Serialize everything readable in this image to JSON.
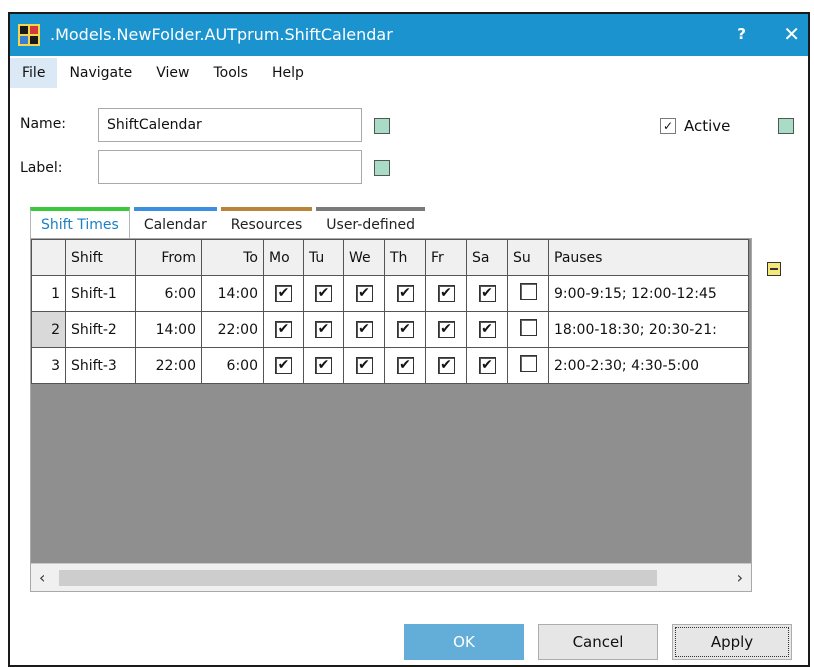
{
  "window": {
    "title": ".Models.NewFolder.AUTprum.ShiftCalendar",
    "help": "?",
    "close": "✕"
  },
  "menu": [
    "File",
    "Navigate",
    "View",
    "Tools",
    "Help"
  ],
  "form": {
    "name_label": "Name:",
    "name_value": "ShiftCalendar",
    "label_label": "Label:",
    "label_value": "",
    "active_label": "Active",
    "active_checked": true
  },
  "tabs": [
    {
      "label": "Shift Times",
      "color": "#3cc83c"
    },
    {
      "label": "Calendar",
      "color": "#3b8fe0"
    },
    {
      "label": "Resources",
      "color": "#b8843a"
    },
    {
      "label": "User-defined",
      "color": "#7a7a7a"
    }
  ],
  "grid": {
    "columns": [
      "Shift",
      "From",
      "To",
      "Mo",
      "Tu",
      "We",
      "Th",
      "Fr",
      "Sa",
      "Su",
      "Pauses"
    ],
    "rows": [
      {
        "num": "1",
        "shift": "Shift-1",
        "from": "6:00",
        "to": "14:00",
        "days": [
          true,
          true,
          true,
          true,
          true,
          true,
          false
        ],
        "pauses": "9:00-9:15; 12:00-12:45"
      },
      {
        "num": "2",
        "shift": "Shift-2",
        "from": "14:00",
        "to": "22:00",
        "days": [
          true,
          true,
          true,
          true,
          true,
          true,
          false
        ],
        "pauses": "18:00-18:30; 20:30-21:"
      },
      {
        "num": "3",
        "shift": "Shift-3",
        "from": "22:00",
        "to": "6:00",
        "days": [
          true,
          true,
          true,
          true,
          true,
          true,
          false
        ],
        "pauses": "2:00-2:30; 4:30-5:00"
      }
    ]
  },
  "buttons": {
    "ok": "OK",
    "cancel": "Cancel",
    "apply": "Apply"
  },
  "colors": {
    "titlebar": "#1b93cf",
    "swatch": "#a8dcc7",
    "ok_button": "#63aed8"
  }
}
